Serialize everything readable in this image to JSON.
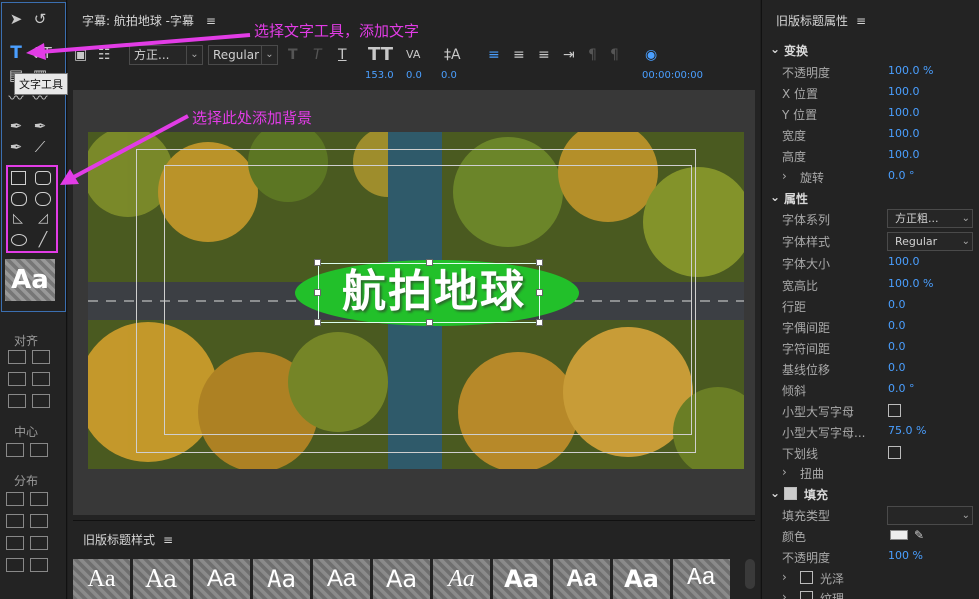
{
  "tools": {
    "text_glyph": "T",
    "tooltip": "文字工具",
    "sample_text": "Aa",
    "align_label": "对齐",
    "center_label": "中心",
    "distribute_label": "分布"
  },
  "annotations": {
    "text_tool_hint": "选择文字工具，添加文字",
    "background_hint": "选择此处添加背景"
  },
  "main": {
    "header": "字幕: 航拍地球 -字幕",
    "menu_icon": "≡",
    "toolbar": {
      "font_family": "方正...",
      "font_style": "Regular",
      "size_value": "153.0",
      "kerning_value": "0.0",
      "leading_value": "0.0",
      "timecode": "00:00:00:00"
    },
    "caption_text": "航拍地球",
    "styles_header": "旧版标题样式",
    "style_samples": [
      "Aa",
      "Aa",
      "Aa",
      "Aa",
      "Aa",
      "Aa",
      "Aa",
      "Aa",
      "Aa",
      "Aa",
      "Aa"
    ]
  },
  "props": {
    "header": "旧版标题属性",
    "transform_label": "变换",
    "opacity_label": "不透明度",
    "opacity_value": "100.0 %",
    "x_label": "X 位置",
    "x_value": "100.0",
    "y_label": "Y 位置",
    "y_value": "100.0",
    "width_label": "宽度",
    "width_value": "100.0",
    "height_label": "高度",
    "height_value": "100.0",
    "rotation_label": "旋转",
    "rotation_value": "0.0 °",
    "attributes_label": "属性",
    "font_family_label": "字体系列",
    "font_family_value": "方正粗...",
    "font_style_label": "字体样式",
    "font_style_value": "Regular",
    "font_size_label": "字体大小",
    "font_size_value": "100.0",
    "aspect_label": "宽高比",
    "aspect_value": "100.0 %",
    "leading_label": "行距",
    "leading_value": "0.0",
    "kerning_label": "字偶间距",
    "kerning_value": "0.0",
    "tracking_label": "字符间距",
    "tracking_value": "0.0",
    "baseline_label": "基线位移",
    "baseline_value": "0.0",
    "slant_label": "倾斜",
    "slant_value": "0.0 °",
    "smallcaps_label": "小型大写字母",
    "smallcaps_size_label": "小型大写字母...",
    "smallcaps_size_value": "75.0 %",
    "underline_label": "下划线",
    "distort_label": "扭曲",
    "fill_label": "填充",
    "fill_type_label": "填充类型",
    "color_label": "颜色",
    "fill_opacity_label": "不透明度",
    "fill_opacity_value": "100 %",
    "sheen_label": "光泽",
    "texture_label": "纹理"
  },
  "colors": {
    "accent": "#4a9fff",
    "annotation": "#e23ce6",
    "caption_bg": "#22c02a"
  }
}
